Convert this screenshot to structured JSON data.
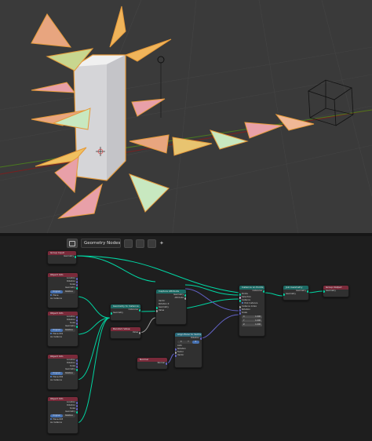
{
  "editor_header": {
    "node_tree_name": "Geometry Nodes"
  },
  "nodes": {
    "group_input": {
      "title": "Group Input",
      "sock": "Geometry"
    },
    "object_info_1": {
      "title": "Object Info",
      "rows": [
        "Location",
        "Rotation",
        "Scale",
        "Geometry"
      ],
      "mode_a": "Original",
      "mode_b": "Relative",
      "obj": "Plane",
      "inst": "As Instance"
    },
    "object_info_2": {
      "title": "Object Info",
      "rows": [
        "Location",
        "Rotation",
        "Scale",
        "Geometry"
      ],
      "mode_a": "Original",
      "mode_b": "Relative",
      "obj": "Plane.001",
      "inst": "As Instance"
    },
    "object_info_3": {
      "title": "Object Info",
      "rows": [
        "Location",
        "Rotation",
        "Scale",
        "Geometry"
      ],
      "mode_a": "Original",
      "mode_b": "Relative",
      "obj": "Plane.002",
      "inst": "As Instance"
    },
    "object_info_4": {
      "title": "Object Info",
      "rows": [
        "Location",
        "Rotation",
        "Scale",
        "Geometry"
      ],
      "mode_a": "Original",
      "mode_b": "Relative",
      "obj": "Plane.003",
      "inst": "As Instance"
    },
    "geometry_to_instance": {
      "title": "Geometry to Instance",
      "out": "Instances",
      "in": "Geometry"
    },
    "random_value": {
      "title": "Random Value",
      "out": "Value"
    },
    "capture_attribute": {
      "title": "Capture Attribute",
      "out1": "Geometry",
      "out2": "Attribute",
      "rows": [
        "Vector",
        "Rotation Z",
        "Geometry",
        "Value"
      ]
    },
    "align_euler": {
      "title": "Align Euler to Vector",
      "out": "Rotation",
      "rows": [
        "X",
        "Y",
        "Z"
      ],
      "pivot": "Auto",
      "rows2": [
        "Rotation",
        "Factor",
        "Vector"
      ]
    },
    "normal": {
      "title": "Normal",
      "out": "Normal"
    },
    "instance_on_points": {
      "title": "Instance on Points",
      "out": "Instances",
      "rows": [
        "Points",
        "Selection",
        "Instance",
        "Pick Instance",
        "Instance Index",
        "Rotation",
        "Scale"
      ],
      "scale_x": "1.000",
      "scale_y": "1.000",
      "scale_z": "1.000"
    },
    "join_geometry": {
      "title": "Join Geometry",
      "out": "Geometry",
      "in": "Geometry"
    },
    "group_output": {
      "title": "Group Output",
      "in": "Geometry"
    }
  }
}
